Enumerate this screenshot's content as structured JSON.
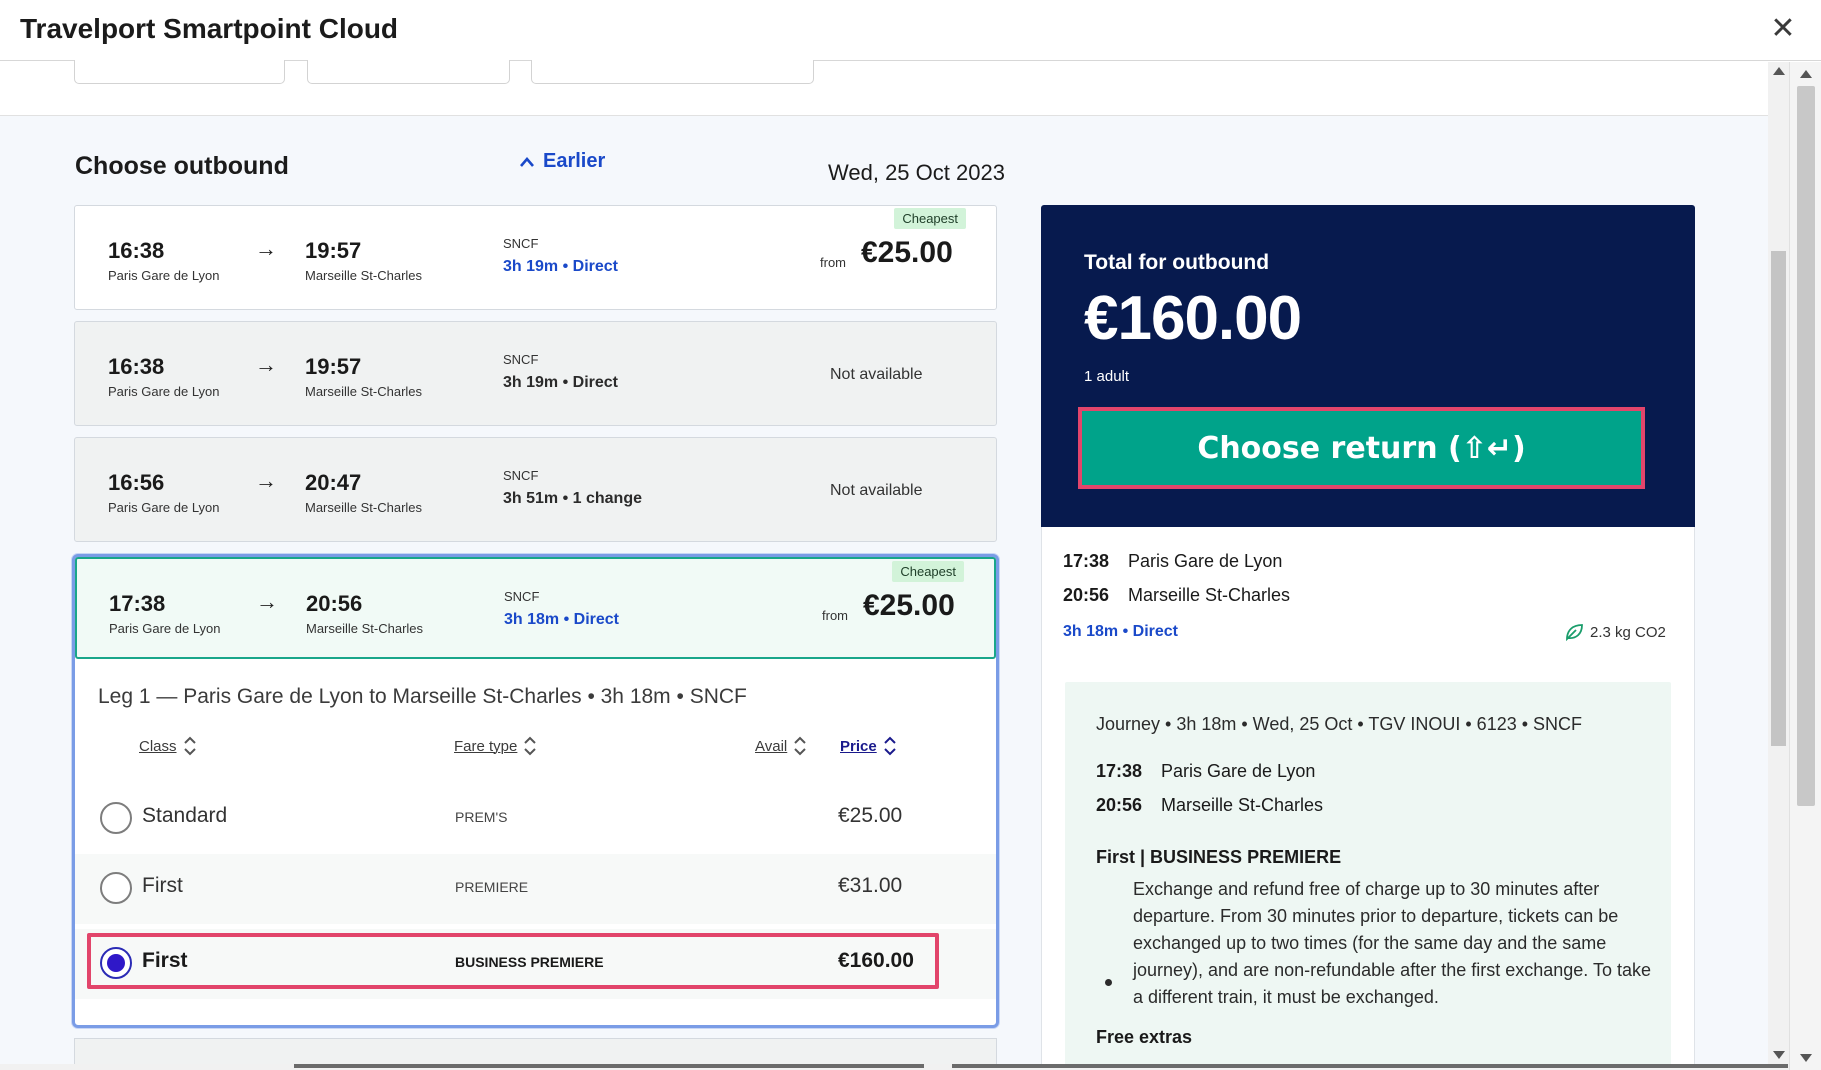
{
  "window": {
    "title": "Travelport Smartpoint Cloud",
    "close_icon": "close-icon"
  },
  "header": {
    "section_title": "Choose outbound",
    "earlier_label": "Earlier",
    "date": "Wed, 25 Oct 2023"
  },
  "journeys": [
    {
      "dep_time": "16:38",
      "dep_station": "Paris Gare de Lyon",
      "arr_time": "19:57",
      "arr_station": "Marseille St-Charles",
      "operator": "SNCF",
      "duration": "3h 19m • Direct",
      "badge": "Cheapest",
      "from": "from",
      "price": "€25.00"
    },
    {
      "dep_time": "16:38",
      "dep_station": "Paris Gare de Lyon",
      "arr_time": "19:57",
      "arr_station": "Marseille St-Charles",
      "operator": "SNCF",
      "duration": "3h 19m • Direct",
      "availability": "Not available"
    },
    {
      "dep_time": "16:56",
      "dep_station": "Paris Gare de Lyon",
      "arr_time": "20:47",
      "arr_station": "Marseille St-Charles",
      "operator": "SNCF",
      "duration": "3h 51m • 1 change",
      "availability": "Not available"
    },
    {
      "dep_time": "17:38",
      "dep_station": "Paris Gare de Lyon",
      "arr_time": "20:56",
      "arr_station": "Marseille St-Charles",
      "operator": "SNCF",
      "duration": "3h 18m • Direct",
      "badge": "Cheapest",
      "from": "from",
      "price": "€25.00"
    }
  ],
  "arrow": "→",
  "leg": {
    "title": "Leg 1 — Paris Gare de Lyon to Marseille St-Charles • 3h 18m • SNCF",
    "columns": {
      "class": "Class",
      "fare_type": "Fare type",
      "avail": "Avail",
      "price": "Price"
    },
    "fares": [
      {
        "class": "Standard",
        "fare_type": "PREM'S",
        "price": "€25.00",
        "selected": false
      },
      {
        "class": "First",
        "fare_type": "PREMIERE",
        "price": "€31.00",
        "selected": false
      },
      {
        "class": "First",
        "fare_type": "BUSINESS PREMIERE",
        "price": "€160.00",
        "selected": true
      }
    ]
  },
  "summary": {
    "label": "Total for outbound",
    "total": "€160.00",
    "passengers": "1 adult",
    "button": "Choose return (⇧↵)",
    "dep_time": "17:38",
    "dep_station": "Paris Gare de Lyon",
    "arr_time": "20:56",
    "arr_station": "Marseille St-Charles",
    "duration": "3h 18m • Direct",
    "co2": "2.3 kg CO2"
  },
  "details": {
    "journey": "Journey • 3h 18m • Wed, 25 Oct • TGV INOUI • 6123 • SNCF",
    "dep_time": "17:38",
    "dep_station": "Paris Gare de Lyon",
    "arr_time": "20:56",
    "arr_station": "Marseille St-Charles",
    "fare_heading": "First | BUSINESS PREMIERE",
    "fare_description": "Exchange and refund free of charge up to 30 minutes after departure. From 30 minutes prior to departure, tickets can be exchanged up to two times (for the same day and the same journey), and are non-refundable after the first exchange. To take a different train, it must be exchanged.",
    "extras_heading": "Free extras"
  },
  "colors": {
    "navy": "#071a4e",
    "teal": "#00a38a",
    "link_blue": "#1a49c9",
    "highlight": "#e2456b",
    "badge_green": "#d2f3d9"
  }
}
